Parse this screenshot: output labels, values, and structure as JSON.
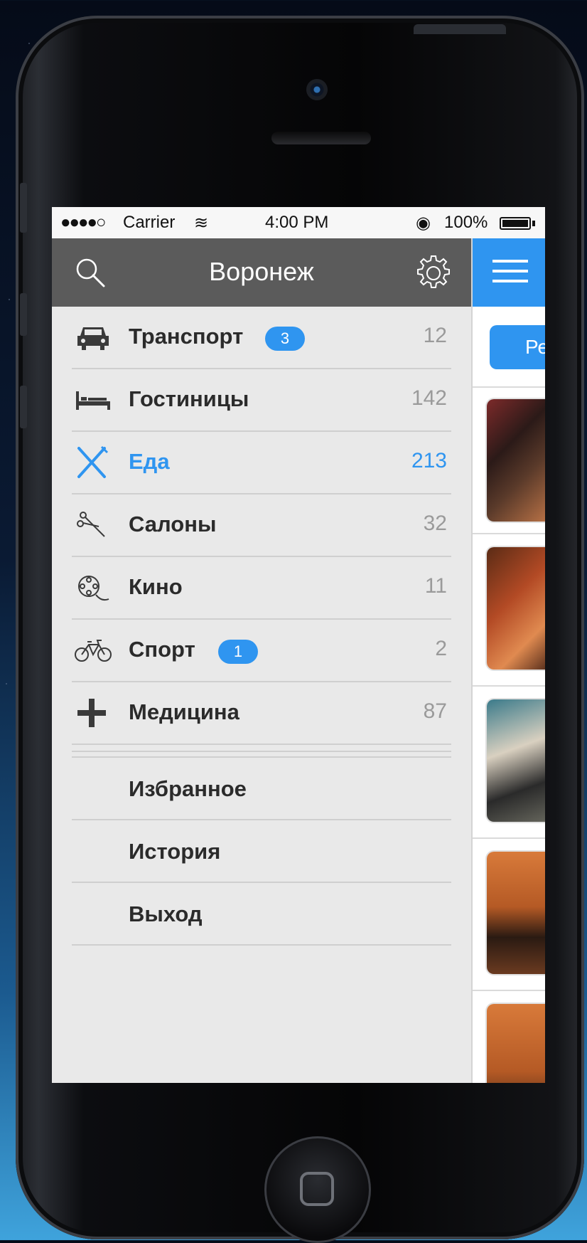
{
  "status_bar": {
    "signal": "●●●●○",
    "carrier": "Carrier",
    "wifi": "≋",
    "time": "4:00 PM",
    "lock": "◉",
    "battery_pct": "100%"
  },
  "menu": {
    "city_title": "Воронеж",
    "items": [
      {
        "label": "Транспорт",
        "count": "12",
        "badge": "3",
        "icon": "car-icon"
      },
      {
        "label": "Гостиницы",
        "count": "142",
        "icon": "bed-icon"
      },
      {
        "label": "Еда",
        "count": "213",
        "icon": "fork-knife-icon",
        "active": true
      },
      {
        "label": "Салоны",
        "count": "32",
        "icon": "scissors-icon"
      },
      {
        "label": "Кино",
        "count": "11",
        "icon": "film-reel-icon"
      },
      {
        "label": "Спорт",
        "count": "2",
        "badge": "1",
        "icon": "bicycle-icon"
      },
      {
        "label": "Медицина",
        "count": "87",
        "icon": "plus-icon"
      }
    ],
    "secondary": [
      {
        "label": "Избранное"
      },
      {
        "label": "История"
      },
      {
        "label": "Выход"
      }
    ]
  },
  "content": {
    "filter_button_label": "Ре"
  },
  "colors": {
    "accent": "#2f95f0",
    "header_bg": "#5b5b5b",
    "menu_bg": "#e9e9e9"
  }
}
